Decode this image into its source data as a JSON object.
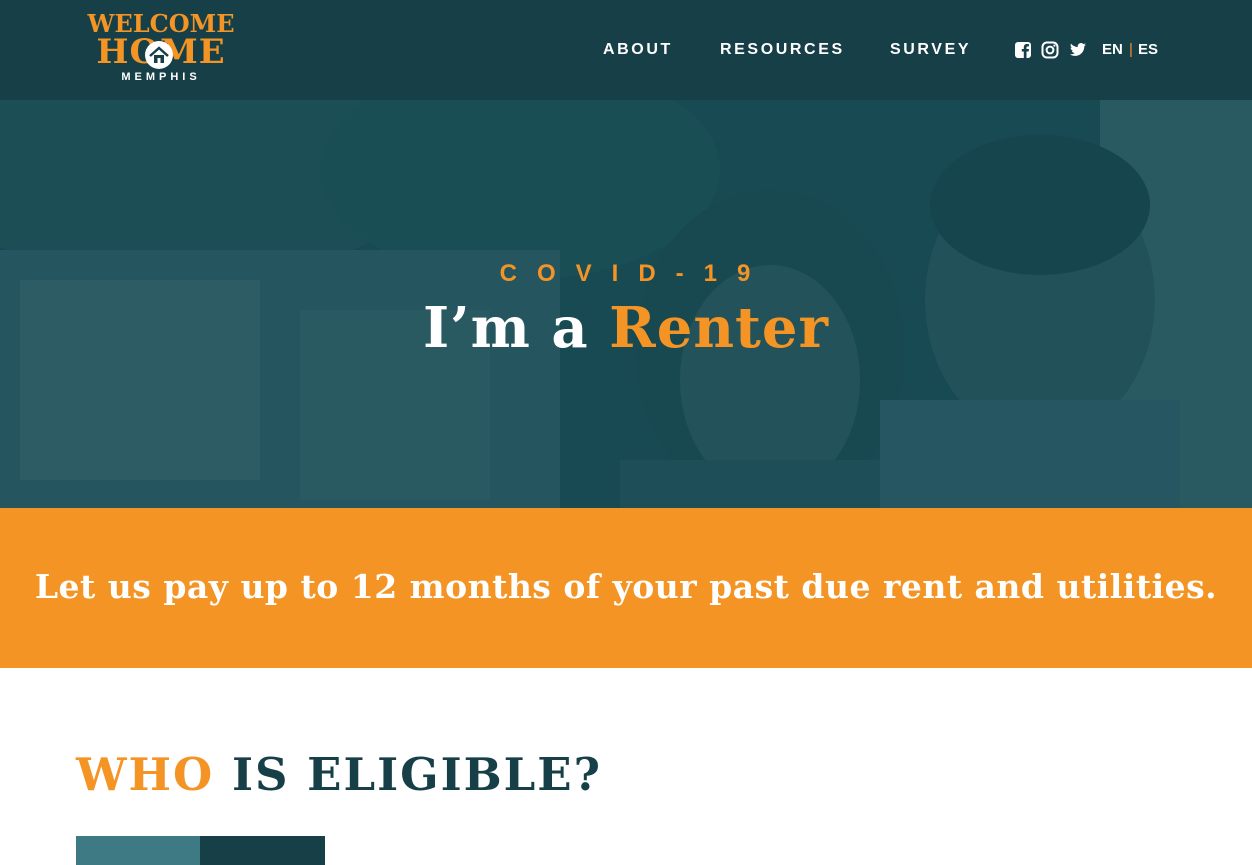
{
  "brand": {
    "logo_line1": "WELCOME",
    "logo_line2": "HOME",
    "logo_line3": "MEMPHIS",
    "orange": "#f39425",
    "teal_dark": "#163f48"
  },
  "nav": {
    "items": [
      {
        "label": "ABOUT"
      },
      {
        "label": "RESOURCES"
      },
      {
        "label": "SURVEY"
      }
    ],
    "social_icons": [
      "facebook-icon",
      "instagram-icon",
      "twitter-icon"
    ],
    "languages": {
      "en": "EN",
      "separator": "|",
      "es": "ES"
    }
  },
  "hero": {
    "eyebrow": "COVID-19",
    "title_prefix": "I’m a",
    "title_highlight": "Renter"
  },
  "banner": {
    "text": "Let us pay up to 12 months of your past due rent and utilities."
  },
  "eligible": {
    "title_highlight": "WHO",
    "title_rest": "IS ELIGIBLE?"
  }
}
